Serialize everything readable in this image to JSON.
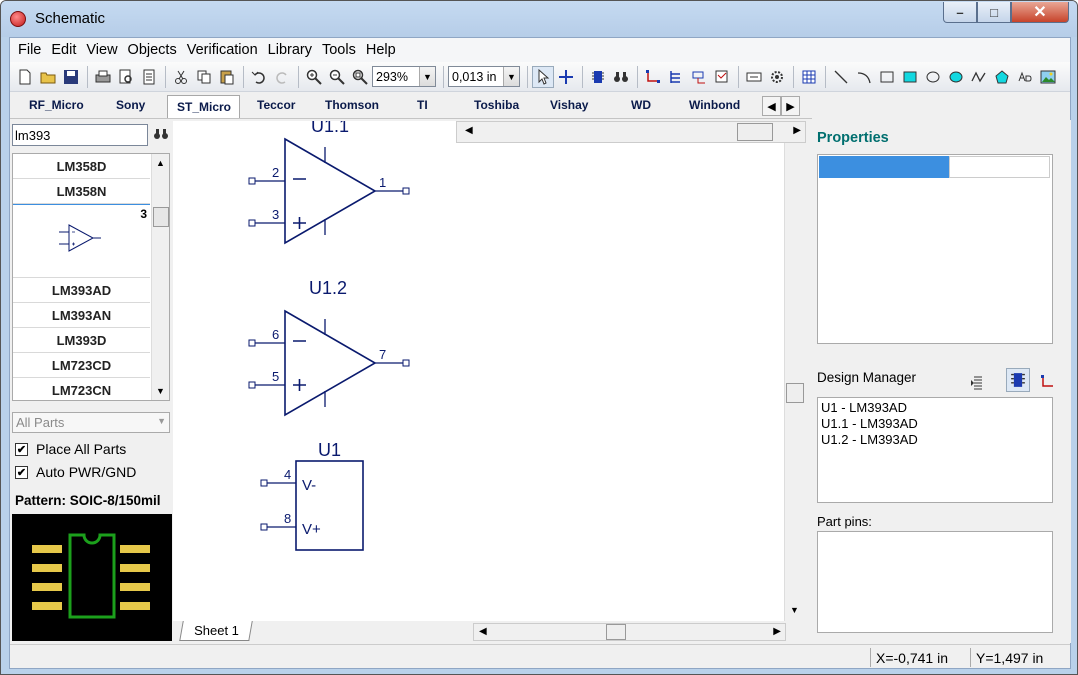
{
  "window": {
    "title": "Schematic",
    "minimize": "–",
    "maximize": "□",
    "close": "✕"
  },
  "menu": [
    "File",
    "Edit",
    "View",
    "Objects",
    "Verification",
    "Library",
    "Tools",
    "Help"
  ],
  "toolbar": {
    "zoom": "293%",
    "grid": "0,013 in",
    "icons": [
      "new-file-icon",
      "open-folder-icon",
      "save-icon",
      "print-icon",
      "print-preview-icon",
      "document-icon",
      "cut-icon",
      "copy-icon",
      "paste-icon",
      "undo-icon",
      "redo-icon",
      "zoom-in-icon",
      "zoom-out-icon",
      "zoom-fit-icon",
      "select-arrow-icon",
      "crosshair-icon",
      "component-icon",
      "binoculars-icon",
      "wire-icon",
      "bus-icon",
      "net-label-icon",
      "netlist-icon",
      "text-box-icon",
      "gear-chip-icon",
      "grid-icon",
      "line-icon",
      "arc-icon",
      "rectangle-icon",
      "filled-rectangle-icon",
      "ellipse-icon",
      "filled-ellipse-icon",
      "polyline-icon",
      "polygon-icon",
      "text-icon",
      "image-icon"
    ]
  },
  "library_tabs": {
    "tabs": [
      "RF_Micro",
      "Sony",
      "ST_Micro",
      "Teccor",
      "Thomson",
      "TI",
      "Toshiba",
      "Vishay",
      "WD",
      "Winbond"
    ],
    "active": "ST_Micro",
    "prev": "◀",
    "next": "▶"
  },
  "left_panel": {
    "search_value": "lm393",
    "parts_above": [
      "LM358D",
      "LM358N"
    ],
    "selected_part_count": "3",
    "parts_below": [
      "LM393AD",
      "LM393AN",
      "LM393D",
      "LM723CD",
      "LM723CN"
    ],
    "filter": "All Parts",
    "place_all_parts": {
      "label": "Place All Parts",
      "checked": true
    },
    "auto_pwr_gnd": {
      "label": "Auto PWR/GND",
      "checked": true
    },
    "pattern": "Pattern: SOIC-8/150mil"
  },
  "schematic": {
    "sheet_tab": "Sheet 1",
    "parts": [
      {
        "ref": "U1.1",
        "pins": {
          "inv": "2",
          "noninv": "3",
          "out": "1"
        }
      },
      {
        "ref": "U1.2",
        "pins": {
          "inv": "6",
          "noninv": "5",
          "out": "7"
        }
      },
      {
        "ref": "U1",
        "pins": {
          "vneg": "4",
          "vpos": "8"
        },
        "labels": {
          "vneg": "V-",
          "vpos": "V+"
        }
      }
    ],
    "minus": "−",
    "plus": "+"
  },
  "right_panel": {
    "properties_title": "Properties",
    "design_manager_title": "Design Manager",
    "design_items": [
      "U1 - LM393AD",
      "U1.1 - LM393AD",
      "U1.2 - LM393AD"
    ],
    "part_pins_title": "Part pins:"
  },
  "status": {
    "x": "X=-0,741 in",
    "y": "Y=1,497 in"
  },
  "colors": {
    "schematic": "#0a1a6e",
    "accent": "#3c8fe0",
    "properties_title": "#006f6f",
    "footprint_pad": "#e6c84a",
    "footprint_body": "#1ca01c"
  }
}
